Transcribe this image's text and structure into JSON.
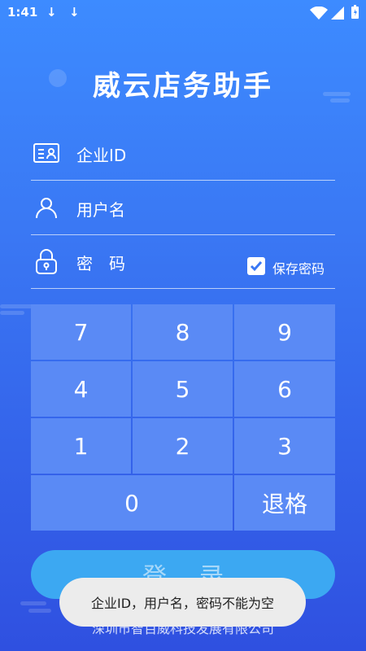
{
  "status_bar": {
    "time": "1:41",
    "download_icon_1": "↓",
    "download_icon_2": "↓"
  },
  "app_title": "威云店务助手",
  "fields": {
    "enterprise_id": {
      "placeholder": "企业ID"
    },
    "username": {
      "placeholder": "用户名"
    },
    "password": {
      "placeholder": "密　码",
      "save_label": "保存密码",
      "save_checked": true
    }
  },
  "keypad": {
    "keys": [
      "7",
      "8",
      "9",
      "4",
      "5",
      "6",
      "1",
      "2",
      "3",
      "0",
      "退格"
    ]
  },
  "login_button": {
    "label": "登录"
  },
  "company": "深圳市智百威科技发展有限公司",
  "toast": "企业ID，用户名，密码不能为空",
  "colors": {
    "background_top": "#3d8bff",
    "background_bottom": "#2f50e0",
    "key_bg": "#5a8af5",
    "login_bg": "#3ca8f2"
  }
}
